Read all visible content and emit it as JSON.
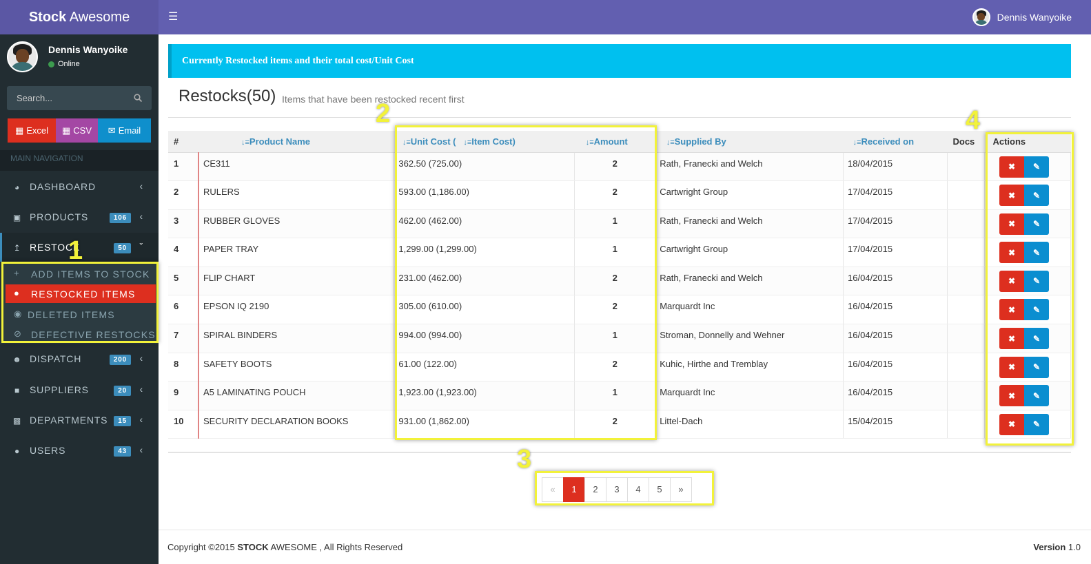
{
  "app": {
    "logo_bold": "Stock",
    "logo_light": " Awesome"
  },
  "header": {
    "user_name": "Dennis Wanyoike",
    "menu_icon": "hamburger-icon"
  },
  "sidebar": {
    "user_name": "Dennis Wanyoike",
    "status": "Online",
    "search_placeholder": "Search...",
    "exports": {
      "excel": "Excel",
      "csv": "CSV",
      "email": "Email"
    },
    "nav_header": "MAIN NAVIGATION",
    "items": [
      {
        "label": "DASHBOARD",
        "icon": "dashboard-icon",
        "badge": ""
      },
      {
        "label": "PRODUCTS",
        "icon": "cart-icon",
        "badge": "106"
      },
      {
        "label": "RESTOCK",
        "icon": "upload-icon",
        "badge": "50"
      },
      {
        "label": "DISPATCH",
        "icon": "user-plus-icon",
        "badge": "200"
      },
      {
        "label": "SUPPLIERS",
        "icon": "truck-icon",
        "badge": "20"
      },
      {
        "label": "DEPARTMENTS",
        "icon": "briefcase-icon",
        "badge": "15"
      },
      {
        "label": "USERS",
        "icon": "users-icon",
        "badge": "43"
      }
    ],
    "submenu": [
      {
        "label": "ADD ITEMS TO STOCK",
        "icon": "plus-icon"
      },
      {
        "label": "RESTOCKED ITEMS",
        "icon": "users-icon"
      },
      {
        "label": "DELETED ITEMS",
        "icon": "eye-slash-icon"
      },
      {
        "label": "DEFECTIVE RESTOCKS",
        "icon": "ban-icon"
      }
    ]
  },
  "main": {
    "callout": "Currently Restocked items and their total cost/Unit Cost",
    "title": "Restocks(50)",
    "subtitle": "Items that have been restocked recent first",
    "columns": {
      "num": "#",
      "product": "Product Name",
      "unit_cost": "Unit Cost (",
      "item_cost": "Item Cost)",
      "amount": "Amount",
      "supplier": "Supplied By",
      "received": "Received on",
      "docs": "Docs",
      "actions": "Actions"
    },
    "rows": [
      {
        "num": "1",
        "product": "CE311",
        "cost": "362.50 (725.00)",
        "amount": "2",
        "supplier": "Rath, Franecki and Welch",
        "received": "18/04/2015"
      },
      {
        "num": "2",
        "product": "RULERS",
        "cost": "593.00 (1,186.00)",
        "amount": "2",
        "supplier": "Cartwright Group",
        "received": "17/04/2015"
      },
      {
        "num": "3",
        "product": "RUBBER GLOVES",
        "cost": "462.00 (462.00)",
        "amount": "1",
        "supplier": "Rath, Franecki and Welch",
        "received": "17/04/2015"
      },
      {
        "num": "4",
        "product": "PAPER TRAY",
        "cost": "1,299.00 (1,299.00)",
        "amount": "1",
        "supplier": "Cartwright Group",
        "received": "17/04/2015"
      },
      {
        "num": "5",
        "product": "FLIP CHART",
        "cost": "231.00 (462.00)",
        "amount": "2",
        "supplier": "Rath, Franecki and Welch",
        "received": "16/04/2015"
      },
      {
        "num": "6",
        "product": "EPSON IQ 2190",
        "cost": "305.00 (610.00)",
        "amount": "2",
        "supplier": "Marquardt Inc",
        "received": "16/04/2015"
      },
      {
        "num": "7",
        "product": "SPIRAL BINDERS",
        "cost": "994.00 (994.00)",
        "amount": "1",
        "supplier": "Stroman, Donnelly and Wehner",
        "received": "16/04/2015"
      },
      {
        "num": "8",
        "product": "SAFETY BOOTS",
        "cost": "61.00 (122.00)",
        "amount": "2",
        "supplier": "Kuhic, Hirthe and Tremblay",
        "received": "16/04/2015"
      },
      {
        "num": "9",
        "product": "A5 LAMINATING POUCH",
        "cost": "1,923.00 (1,923.00)",
        "amount": "1",
        "supplier": "Marquardt Inc",
        "received": "16/04/2015"
      },
      {
        "num": "10",
        "product": "SECURITY DECLARATION BOOKS",
        "cost": "931.00 (1,862.00)",
        "amount": "2",
        "supplier": "Littel-Dach",
        "received": "15/04/2015"
      }
    ],
    "pagination": {
      "prev": "«",
      "pages": [
        "1",
        "2",
        "3",
        "4",
        "5"
      ],
      "next": "»",
      "current": "1"
    }
  },
  "footer": {
    "copyright_prefix": "Copyright ©2015 ",
    "brand_bold": "STOCK",
    "brand_light": " AWESOME",
    "rights": " , All Rights Reserved",
    "version_label": "Version",
    "version": " 1.0"
  },
  "annotations": [
    "1",
    "2",
    "3",
    "4"
  ],
  "colors": {
    "header": "#625fb0",
    "logo": "#5b57a4",
    "sidebar": "#222d32",
    "accent_red": "#dd2f1f",
    "accent_blue": "#0b8ed0",
    "callout": "#00c0ef",
    "annotation": "#f2f23a"
  }
}
